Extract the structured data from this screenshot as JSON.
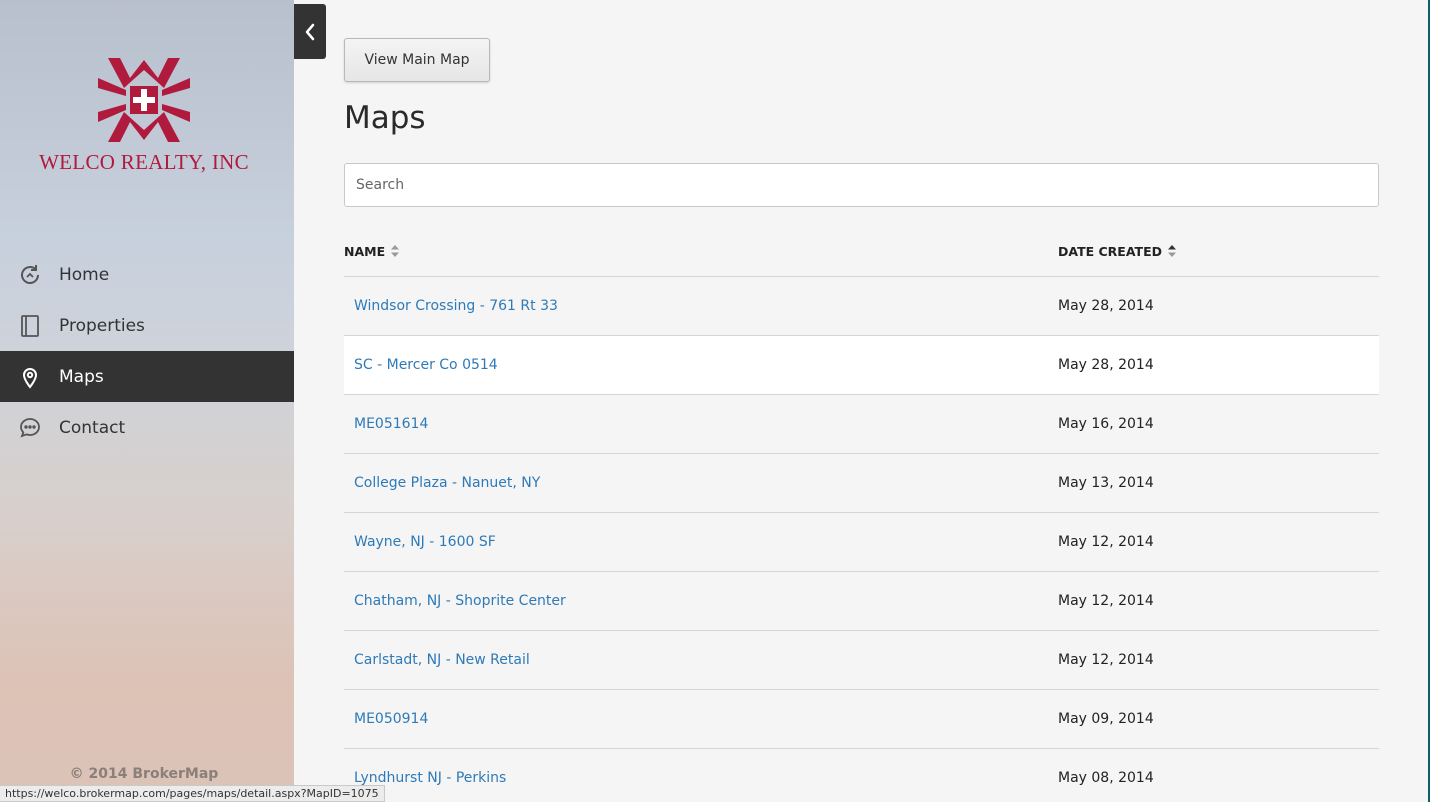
{
  "brand": {
    "company_name": "WELCO REALTY, INC",
    "accent_color": "#b01a3c"
  },
  "sidebar": {
    "items": [
      {
        "label": "Home",
        "icon": "refresh-circle-icon"
      },
      {
        "label": "Properties",
        "icon": "book-icon"
      },
      {
        "label": "Maps",
        "icon": "map-pin-icon",
        "active": true
      },
      {
        "label": "Contact",
        "icon": "chat-bubble-icon"
      }
    ],
    "copyright": "© 2014 BrokerMap"
  },
  "main": {
    "view_main_map_label": "View Main Map",
    "title": "Maps",
    "search_placeholder": "Search",
    "columns": {
      "name": "NAME",
      "date": "DATE CREATED"
    },
    "rows": [
      {
        "name": "Windsor Crossing - 761 Rt 33",
        "date": "May 28, 2014"
      },
      {
        "name": "SC - Mercer Co 0514",
        "date": "May 28, 2014"
      },
      {
        "name": "ME051614",
        "date": "May 16, 2014"
      },
      {
        "name": "College Plaza - Nanuet, NY",
        "date": "May 13, 2014"
      },
      {
        "name": "Wayne, NJ - 1600 SF",
        "date": "May 12, 2014"
      },
      {
        "name": "Chatham, NJ - Shoprite Center",
        "date": "May 12, 2014"
      },
      {
        "name": "Carlstadt, NJ - New Retail",
        "date": "May 12, 2014"
      },
      {
        "name": "ME050914",
        "date": "May 09, 2014"
      },
      {
        "name": "Lyndhurst NJ - Perkins",
        "date": "May 08, 2014"
      }
    ]
  },
  "status_url": "https://welco.brokermap.com/pages/maps/detail.aspx?MapID=1075"
}
